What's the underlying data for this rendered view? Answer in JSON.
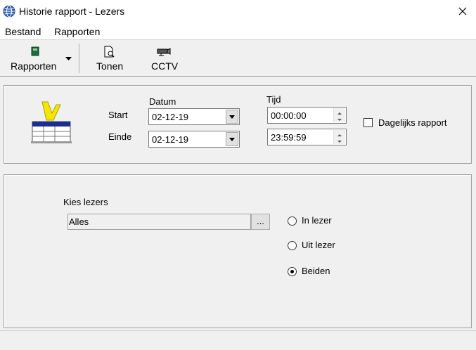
{
  "window": {
    "title": "Historie rapport - Lezers"
  },
  "menu": [
    "Bestand",
    "Rapporten"
  ],
  "toolbar": {
    "rapporten_label": "Rapporten",
    "tonen_label": "Tonen",
    "cctv_label": "CCTV"
  },
  "period": {
    "datum_header": "Datum",
    "tijd_header": "Tijd",
    "start_label": "Start",
    "einde_label": "Einde",
    "start_date": "02-12-19",
    "end_date": "02-12-19",
    "start_time": "00:00:00",
    "end_time": "23:59:59",
    "daily_report_label": "Dagelijks rapport",
    "daily_report_checked": false
  },
  "readers": {
    "label": "Kies lezers",
    "value": "Alles",
    "browse_label": "...",
    "options": [
      "In lezer",
      "Uit lezer",
      "Beiden"
    ],
    "selected": "Beiden"
  }
}
